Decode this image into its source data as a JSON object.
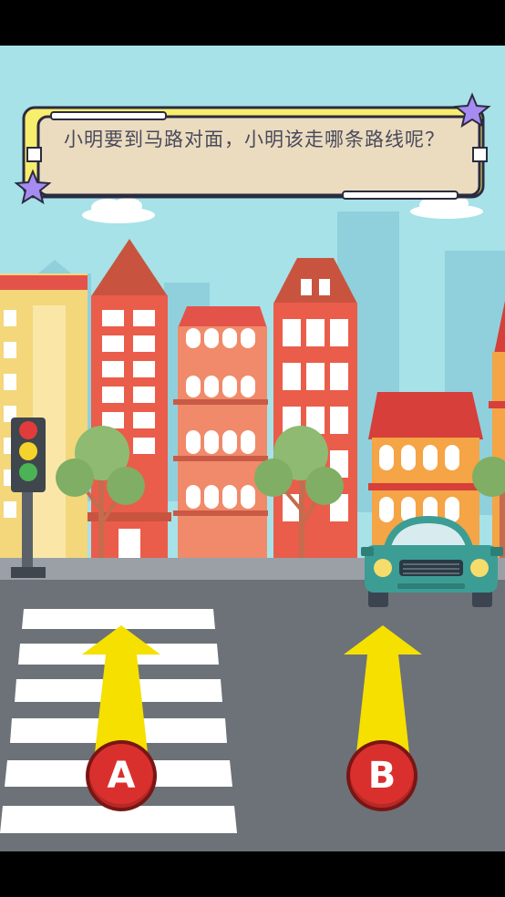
{
  "question": {
    "text": "小明要到马路对面，小明该走哪条路线呢？"
  },
  "options": [
    {
      "id": "A",
      "label": "A"
    },
    {
      "id": "B",
      "label": "B"
    }
  ],
  "traffic_light": {
    "lights": [
      "red",
      "yellow",
      "green"
    ]
  },
  "colors": {
    "sky": "#a6e2e8",
    "road": "#6c7278",
    "arrow": "#f5e000",
    "choice_circle": "#d9302e",
    "bubble_border": "#2b2b40",
    "bubble_accent": "#f7ee6e",
    "star": "#a68cf0"
  }
}
